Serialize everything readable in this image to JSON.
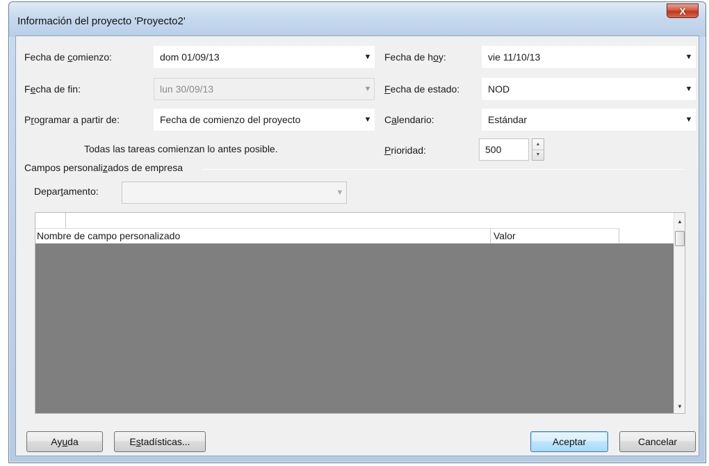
{
  "window": {
    "title": "Información del proyecto 'Proyecto2'",
    "close_glyph": "X"
  },
  "fields": {
    "start_date": {
      "label_pre": "Fecha de ",
      "label_u": "c",
      "label_post": "omienzo:",
      "value": "dom 01/09/13"
    },
    "finish_date": {
      "label_pre": "F",
      "label_u": "e",
      "label_post": "cha de fin:",
      "value": "lun 30/09/13"
    },
    "schedule_from": {
      "label_pre": "P",
      "label_u": "r",
      "label_post": "ogramar a partir de:",
      "value": "Fecha de comienzo del proyecto"
    },
    "schedule_note": "Todas las tareas comienzan lo antes posible.",
    "current_date": {
      "label_pre": "Fecha de h",
      "label_u": "o",
      "label_post": "y:",
      "value": "vie 11/10/13"
    },
    "status_date": {
      "label_pre": "",
      "label_u": "F",
      "label_post": "echa de estado:",
      "value": "NOD"
    },
    "calendar": {
      "label_pre": "C",
      "label_u": "a",
      "label_post": "lendario:",
      "value": "Estándar"
    },
    "priority": {
      "label_pre": "",
      "label_u": "P",
      "label_post": "rioridad:",
      "value": "500"
    }
  },
  "enterprise": {
    "group_label_pre": "Campos personali",
    "group_label_u": "z",
    "group_label_post": "ados de empresa",
    "department_label_pre": "Depar",
    "department_label_u": "t",
    "department_label_post": "amento:",
    "department_value": ""
  },
  "grid": {
    "col_name": "Nombre de campo personalizado",
    "col_value": "Valor"
  },
  "buttons": {
    "help_pre": "Ay",
    "help_u": "u",
    "help_post": "da",
    "stats_pre": "E",
    "stats_u": "s",
    "stats_post": "tadísticas...",
    "ok": "Aceptar",
    "cancel": "Cancelar"
  },
  "icons": {
    "dropdown": "chevron-down-icon",
    "spin_up": "spin-up-icon",
    "spin_down": "spin-down-icon"
  }
}
